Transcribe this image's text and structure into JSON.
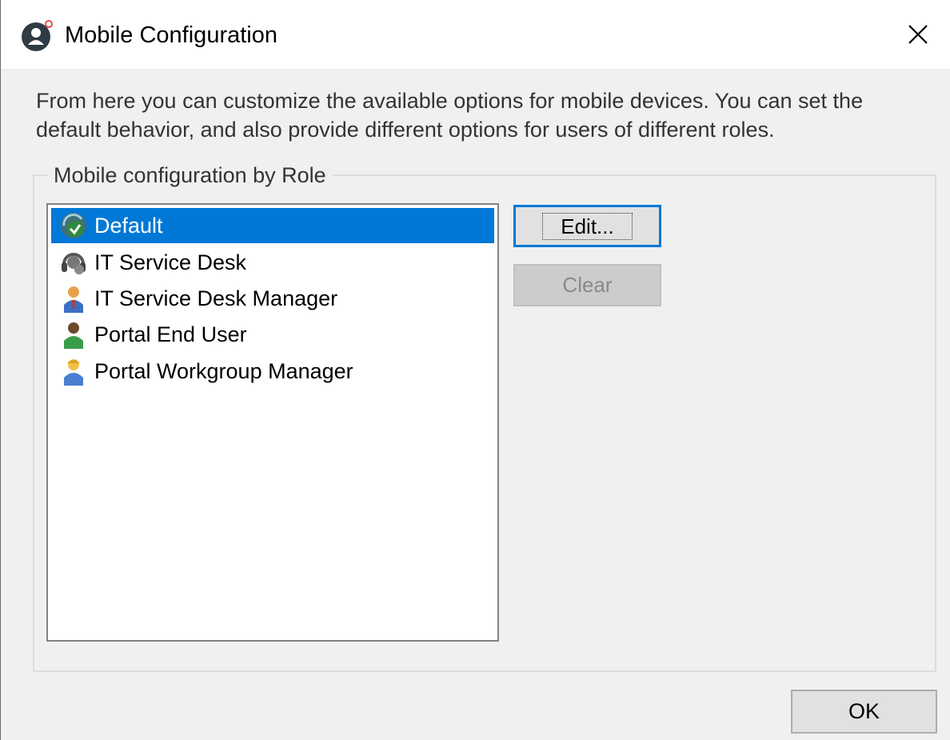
{
  "window": {
    "title": "Mobile Configuration"
  },
  "description": "From here you can customize the available options for mobile devices. You can set the default behavior, and also provide different options for users of different roles.",
  "group": {
    "label": "Mobile configuration by Role"
  },
  "roles": [
    {
      "label": "Default",
      "icon": "default-role-icon",
      "selected": true
    },
    {
      "label": "IT Service Desk",
      "icon": "headset-icon",
      "selected": false
    },
    {
      "label": "IT Service Desk Manager",
      "icon": "manager-user-icon",
      "selected": false
    },
    {
      "label": "Portal End User",
      "icon": "end-user-icon",
      "selected": false
    },
    {
      "label": "Portal Workgroup Manager",
      "icon": "workgroup-manager-icon",
      "selected": false
    }
  ],
  "buttons": {
    "edit": "Edit...",
    "clear": "Clear",
    "ok": "OK"
  },
  "colors": {
    "selection": "#0078d7",
    "dialog_bg": "#f0f0f0"
  }
}
